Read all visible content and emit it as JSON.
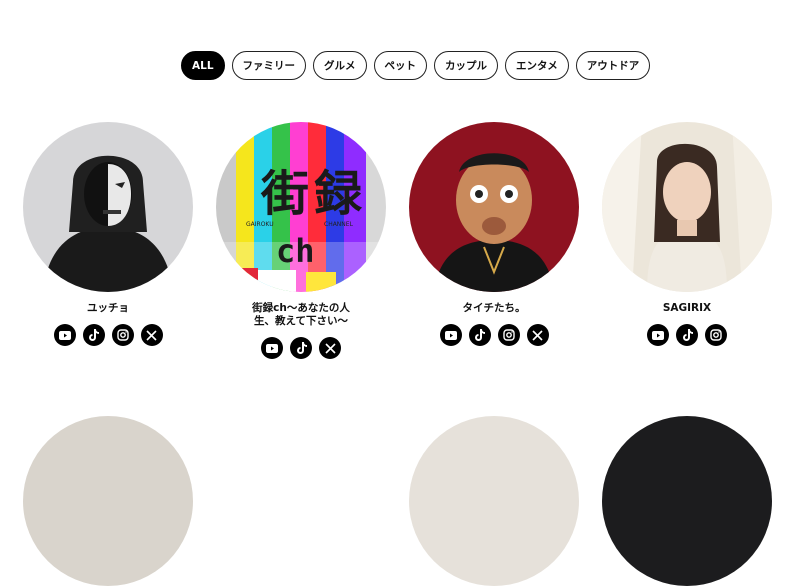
{
  "filters": [
    "ALL",
    "ファミリー",
    "グルメ",
    "ペット",
    "カップル",
    "エンタメ",
    "アウトドア"
  ],
  "active_filter": "ALL",
  "creators": [
    {
      "name": "ユッチョ",
      "socials": [
        "youtube-icon",
        "tiktok-icon",
        "instagram-icon",
        "x-icon"
      ]
    },
    {
      "name": "街録ch〜あなたの人\n生、教えて下さい〜",
      "avatar_text": {
        "main1": "街",
        "main2": "録",
        "sub": "ch",
        "left": "GAIROKU",
        "right": "CHANNEL"
      },
      "socials": [
        "youtube-icon",
        "tiktok-icon",
        "x-icon"
      ]
    },
    {
      "name": "タイチたち。",
      "socials": [
        "youtube-icon",
        "tiktok-icon",
        "instagram-icon",
        "x-icon"
      ]
    },
    {
      "name": "SAGIRIX",
      "socials": [
        "youtube-icon",
        "tiktok-icon",
        "instagram-icon"
      ]
    }
  ],
  "colors": {
    "chip_active_bg": "#000000",
    "social_bg": "#000000"
  }
}
